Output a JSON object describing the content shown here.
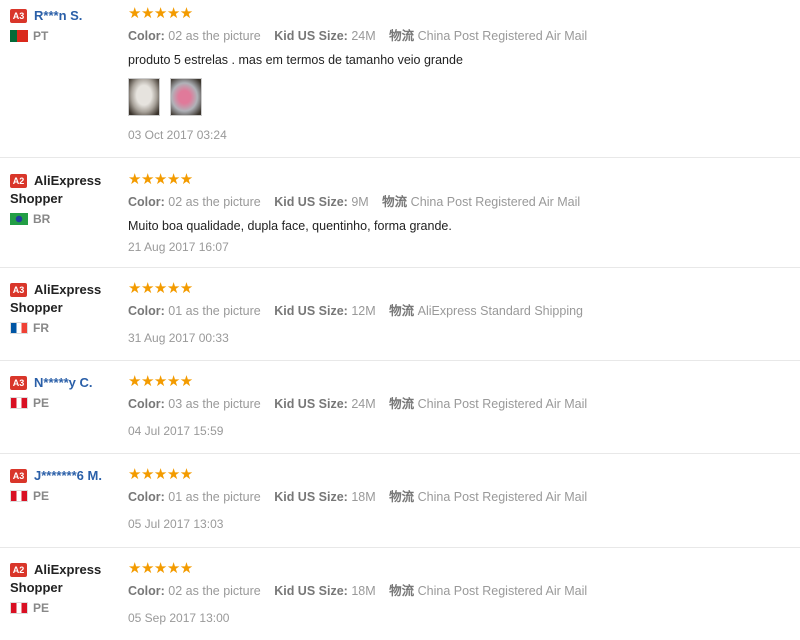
{
  "labels": {
    "color": "Color:",
    "size": "Kid US Size:",
    "shipping": "物流"
  },
  "reviews": [
    {
      "badge": "A3",
      "name": "R***n S.",
      "name2": "",
      "country": "PT",
      "stars": "★★★★★",
      "color": "02 as the picture",
      "size": "24M",
      "shipping": "China Post Registered Air Mail",
      "text": "produto 5 estrelas . mas em termos de tamanho veio grande",
      "date": "03 Oct 2017 03:24"
    },
    {
      "badge": "A2",
      "name": "AliExpress",
      "name2": "Shopper",
      "country": "BR",
      "stars": "★★★★★",
      "color": "02 as the picture",
      "size": "9M",
      "shipping": "China Post Registered Air Mail",
      "text": "Muito boa qualidade, dupla face, quentinho, forma grande.",
      "date": "21 Aug 2017 16:07"
    },
    {
      "badge": "A3",
      "name": "AliExpress",
      "name2": "Shopper",
      "country": "FR",
      "stars": "★★★★★",
      "color": "01 as the picture",
      "size": "12M",
      "shipping": "AliExpress Standard Shipping",
      "text": "",
      "date": "31 Aug 2017 00:33"
    },
    {
      "badge": "A3",
      "name": "N*****y C.",
      "name2": "",
      "country": "PE",
      "stars": "★★★★★",
      "color": "03 as the picture",
      "size": "24M",
      "shipping": "China Post Registered Air Mail",
      "text": "",
      "date": "04 Jul 2017 15:59"
    },
    {
      "badge": "A3",
      "name": "J*******6 M.",
      "name2": "",
      "country": "PE",
      "stars": "★★★★★",
      "color": "01 as the picture",
      "size": "18M",
      "shipping": "China Post Registered Air Mail",
      "text": "",
      "date": "05 Jul 2017 13:03"
    },
    {
      "badge": "A2",
      "name": "AliExpress",
      "name2": "Shopper",
      "country": "PE",
      "stars": "★★★★★",
      "color": "02 as the picture",
      "size": "18M",
      "shipping": "China Post Registered Air Mail",
      "text": "",
      "date": "05 Sep 2017 13:00"
    }
  ]
}
